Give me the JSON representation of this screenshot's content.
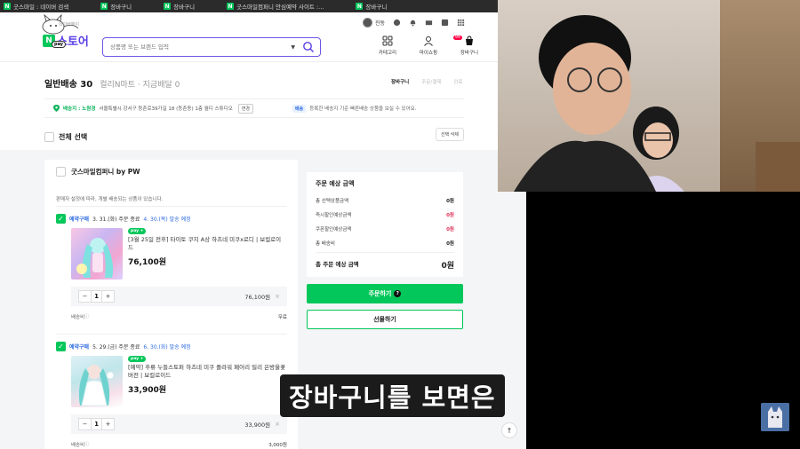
{
  "bookmarks": [
    {
      "icon": "N",
      "label": "굿스마일 : 네이버 검색"
    },
    {
      "icon": "N",
      "label": "장바구니"
    },
    {
      "icon": "N",
      "label": "장바구니"
    },
    {
      "icon": "N",
      "label": "굿스마일컴퍼니 안심예약 사이트 :..."
    },
    {
      "icon": "N",
      "label": "장바구니"
    }
  ],
  "header": {
    "logo_letter": "N",
    "logo_pay": "pay",
    "logo_text": "스토어",
    "brand_sub": "네이버페이",
    "search_placeholder": "상품명 또는 브랜드 입력",
    "user_name": "진동",
    "nav": [
      {
        "icon": "category-icon",
        "label": "카테고리"
      },
      {
        "icon": "my-shopping-icon",
        "label": "마이쇼핑"
      },
      {
        "icon": "cart-icon",
        "label": "장바구니"
      }
    ],
    "cart_count": "99"
  },
  "page_title": {
    "main": "일반배송 30",
    "sub": "컬리N마트 · 지금배달 0"
  },
  "steps": {
    "step1": "장바구니",
    "step2": "주문/결제",
    "step3": "완료"
  },
  "address": {
    "label": "배송지 : 노원경",
    "text": "서울특별시 강서구 등촌로39가길 18 (등촌동) 1층 월디 스튜디오",
    "change_btn": "변경",
    "delivery_badge": "배송",
    "delivery_text": "등록한 배송지 기준 빠른배송 상품을 보실 수 있어요."
  },
  "select_all": {
    "label": "전체 선택",
    "delete_btn": "선택 삭제"
  },
  "seller": {
    "name": "굿스마일컴퍼니 by PW",
    "note": "판매자 설정에 따라, 개별 배송되는 상품이 있습니다."
  },
  "items": [
    {
      "ship_type": "예약구매",
      "ship_info": "3. 31.(화) 주문 종료",
      "ship_due": "4. 30.(목) 발송 예정",
      "badge": "pay +",
      "title": "[3월 25일 전후] 타이토 쿠지 A상 하츠네 미쿠x로디 | 보컬로이드",
      "price": "76,100원",
      "qty": "1",
      "line_price": "76,100원",
      "fee_label": "배송비",
      "fee_value": "무료"
    },
    {
      "ship_type": "예약구매",
      "ship_info": "5. 29.(금) 주문 종료",
      "ship_due": "6. 30.(화) 발송 예정",
      "badge": "pay +",
      "title": "[예약] 후류 누들스토퍼 하츠네 미쿠 플라워 페어리 릴리 은방울꽃 버전 | 보컬로이드",
      "price": "33,900원",
      "qty": "1",
      "line_price": "33,900원",
      "fee_label": "배송비",
      "fee_value": "3,000원"
    }
  ],
  "summary": {
    "title": "주문 예상 금액",
    "rows": [
      {
        "label": "총 선택상품금액",
        "value": "0원"
      },
      {
        "label": "즉시할인예상금액",
        "value": "0원"
      },
      {
        "label": "쿠폰할인예상금액",
        "value": "0원"
      },
      {
        "label": "총 배송비",
        "value": "0원"
      }
    ],
    "total_label": "총 주문 예상 금액",
    "total_value": "0원"
  },
  "buttons": {
    "order": "주문하기",
    "gift": "선물하기"
  },
  "subtitle": "장바구니를 보면은",
  "colors": {
    "brand_green": "#03c75a",
    "accent_purple": "#6b56e8",
    "link_blue": "#2d6be0",
    "discount_red": "#e0305a"
  }
}
